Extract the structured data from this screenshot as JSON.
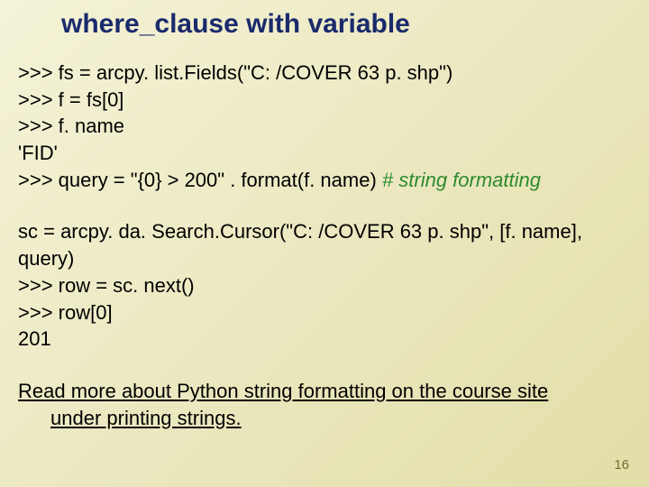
{
  "title": "where_clause with variable",
  "code1": {
    "l1": ">>> fs = arcpy. list.Fields(\"C: /COVER 63 p. shp\")",
    "l2": ">>> f = fs[0]",
    "l3": ">>> f. name",
    "l4": "'FID'",
    "l5a": ">>> query = \"{0} > 200\" . format(f. name) ",
    "l5b": "# string formatting"
  },
  "code2": {
    "l1": "sc = arcpy. da. Search.Cursor(\"C: /COVER 63 p. shp\", [f. name], query)",
    "l2": ">>> row = sc. next()",
    "l3": ">>> row[0]",
    "l4": "201"
  },
  "link": {
    "line1": "Read more about Python string formatting on the course site",
    "line2": "under printing strings."
  },
  "pagenum": "16"
}
